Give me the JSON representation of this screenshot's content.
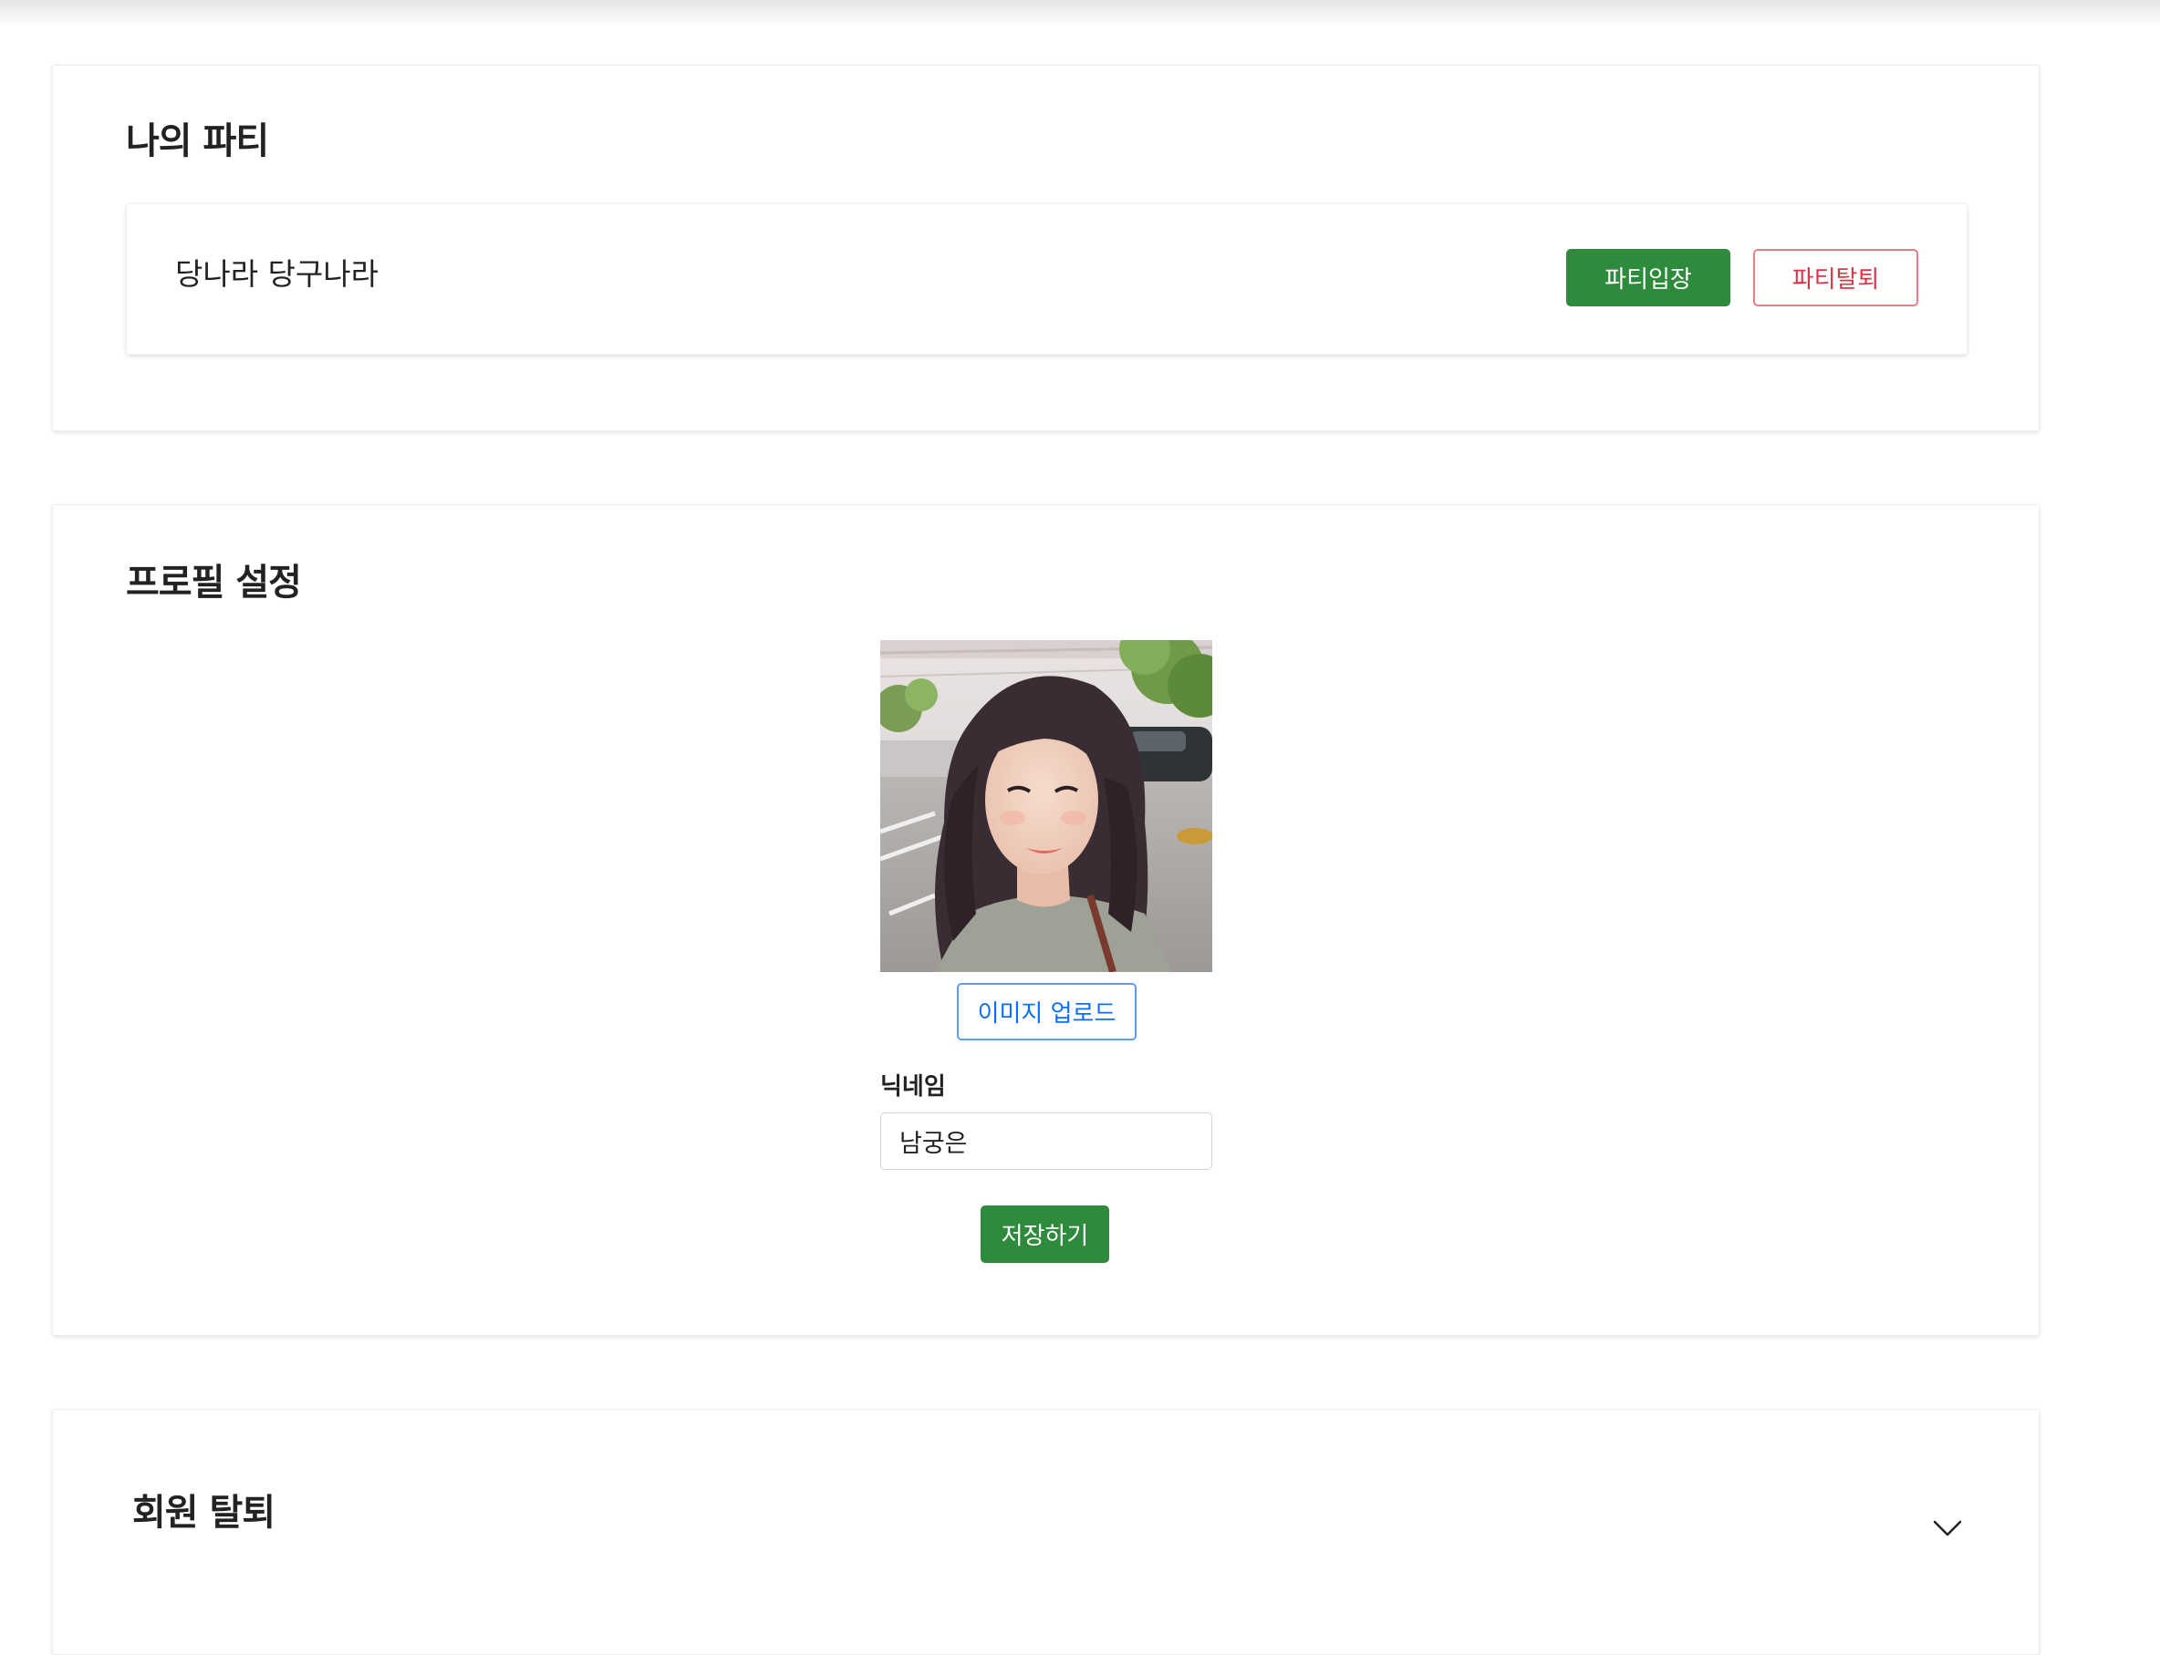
{
  "party_section": {
    "title": "나의 파티",
    "party_name": "당나라 당구나라",
    "enter_button": "파티입장",
    "leave_button": "파티탈퇴"
  },
  "profile_section": {
    "title": "프로필 설정",
    "upload_button": "이미지 업로드",
    "nickname_label": "닉네임",
    "nickname_value": "남궁은",
    "save_button": "저장하기"
  },
  "withdraw_section": {
    "title": "회원 탈퇴",
    "toggle_icon": "chevron-down-icon"
  },
  "colors": {
    "primary_green": "#2e8b3c",
    "danger_red": "#dc3545",
    "upload_blue": "#0d6efd"
  }
}
